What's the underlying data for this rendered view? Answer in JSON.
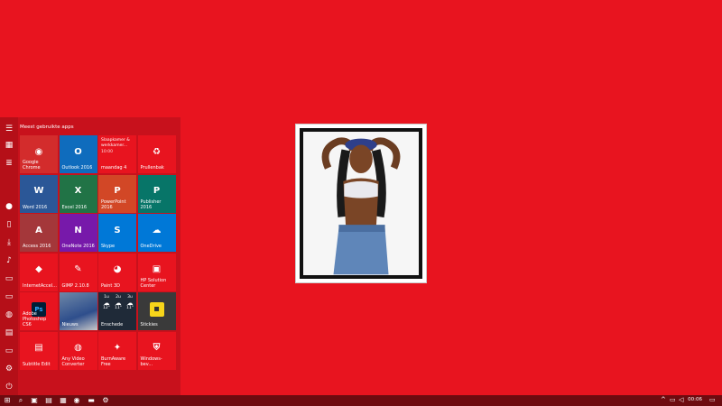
{
  "start_menu": {
    "section_title": "Meest gebruikte apps",
    "tiles": [
      {
        "label": "Google Chrome",
        "icon": "chrome-icon",
        "color": "#d32c2c"
      },
      {
        "label": "Outlook 2016",
        "icon": "outlook-icon",
        "color": "#0f6cbd"
      },
      {
        "label": "maandag 4",
        "icon": "calendar-icon",
        "color": "#e8141f",
        "detail_line1": "Slaapkamer & werkkamer...",
        "detail_line2": "10:00"
      },
      {
        "label": "Prullenbak",
        "icon": "recycle-bin-icon",
        "color": "#e8141f"
      },
      {
        "label": "Word 2016",
        "icon": "word-icon",
        "color": "#2b5797"
      },
      {
        "label": "Excel 2016",
        "icon": "excel-icon",
        "color": "#217346"
      },
      {
        "label": "PowerPoint 2016",
        "icon": "powerpoint-icon",
        "color": "#d24726"
      },
      {
        "label": "Publisher 2016",
        "icon": "publisher-icon",
        "color": "#077568"
      },
      {
        "label": "Access 2016",
        "icon": "access-icon",
        "color": "#a4373a"
      },
      {
        "label": "OneNote 2016",
        "icon": "onenote-icon",
        "color": "#7719aa"
      },
      {
        "label": "Skype",
        "icon": "skype-icon",
        "color": "#0078d7"
      },
      {
        "label": "OneDrive",
        "icon": "onedrive-icon",
        "color": "#0078d7"
      },
      {
        "label": "InternetAccel...",
        "icon": "internet-accelerator-icon",
        "color": "#e8141f"
      },
      {
        "label": "GIMP 2.10.8",
        "icon": "gimp-icon",
        "color": "#e8141f"
      },
      {
        "label": "Paint 3D",
        "icon": "paint3d-icon",
        "color": "#e8141f"
      },
      {
        "label": "HP Solution Center",
        "icon": "hp-icon",
        "color": "#e8141f"
      },
      {
        "label": "Adobe Photoshop CS6",
        "icon": "photoshop-icon",
        "color": "#e8141f"
      },
      {
        "label": "Nieuws",
        "icon": "news-icon",
        "color": "#3b6bb0"
      },
      {
        "label": "Enschede",
        "icon": "weather-icon",
        "color": "#1f2a38"
      },
      {
        "label": "Stickies",
        "icon": "stickies-icon",
        "color": "#3a3a3a"
      },
      {
        "label": "Subtitle Edit",
        "icon": "subtitle-edit-icon",
        "color": "#e8141f"
      },
      {
        "label": "Any Video Converter",
        "icon": "video-converter-icon",
        "color": "#e8141f"
      },
      {
        "label": "BurnAware Free",
        "icon": "burnaware-icon",
        "color": "#e8141f"
      },
      {
        "label": "Windows-bev...",
        "icon": "windows-security-icon",
        "color": "#e8141f"
      }
    ],
    "weather": {
      "days": [
        "1u",
        "2u",
        "3u"
      ],
      "temps": [
        "12°",
        "11°",
        "11°"
      ]
    }
  },
  "taskbar": {
    "time": "00:06"
  }
}
